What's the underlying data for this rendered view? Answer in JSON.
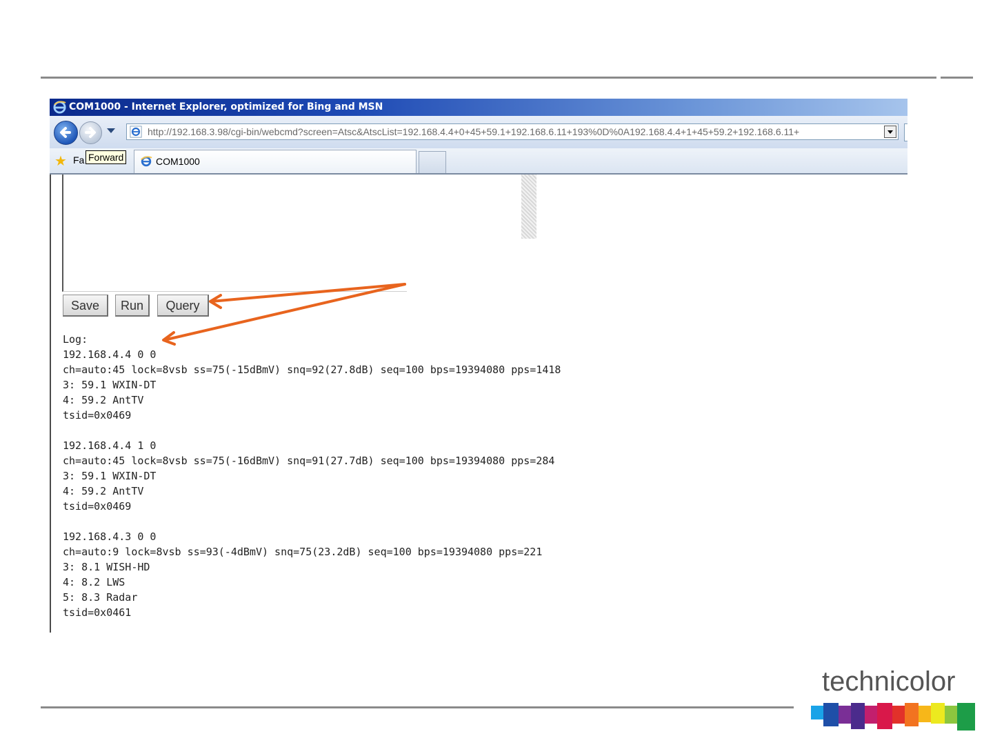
{
  "window": {
    "title": "COM1000 - Internet Explorer, optimized for Bing and MSN"
  },
  "address_bar": {
    "url": "http://192.168.3.98/cgi-bin/webcmd?screen=Atsc&AtscList=192.168.4.4+0+45+59.1+192.168.6.11+193%0D%0A192.168.4.4+1+45+59.2+192.168.6.11+"
  },
  "favorites_bar": {
    "label": "Fa",
    "tooltip": "Forward",
    "tab_label": "COM1000"
  },
  "page": {
    "buttons": {
      "save": "Save",
      "run": "Run",
      "query": "Query"
    },
    "log": [
      "Log:",
      "192.168.4.4 0 0",
      "ch=auto:45 lock=8vsb ss=75(-15dBmV) snq=92(27.8dB) seq=100 bps=19394080 pps=1418",
      "3: 59.1 WXIN-DT",
      "4: 59.2 AntTV",
      "tsid=0x0469",
      "",
      "192.168.4.4 1 0",
      "ch=auto:45 lock=8vsb ss=75(-16dBmV) snq=91(27.7dB) seq=100 bps=19394080 pps=284",
      "3: 59.1 WXIN-DT",
      "4: 59.2 AntTV",
      "tsid=0x0469",
      "",
      "192.168.4.3 0 0",
      "ch=auto:9 lock=8vsb ss=93(-4dBmV) snq=75(23.2dB) seq=100 bps=19394080 pps=221",
      "3: 8.1 WISH-HD",
      "4: 8.2 LWS",
      "5: 8.3 Radar",
      "tsid=0x0461"
    ]
  },
  "brand": {
    "name": "technicolor"
  },
  "colors": {
    "annotation_arrow": "#e8641e",
    "titlebar": "#1d49b4",
    "rule": "#8a8a8a"
  },
  "icons": {
    "browser": "ie-e-icon",
    "back": "back-arrow-icon",
    "forward": "forward-arrow-icon",
    "favorites": "star-icon"
  }
}
